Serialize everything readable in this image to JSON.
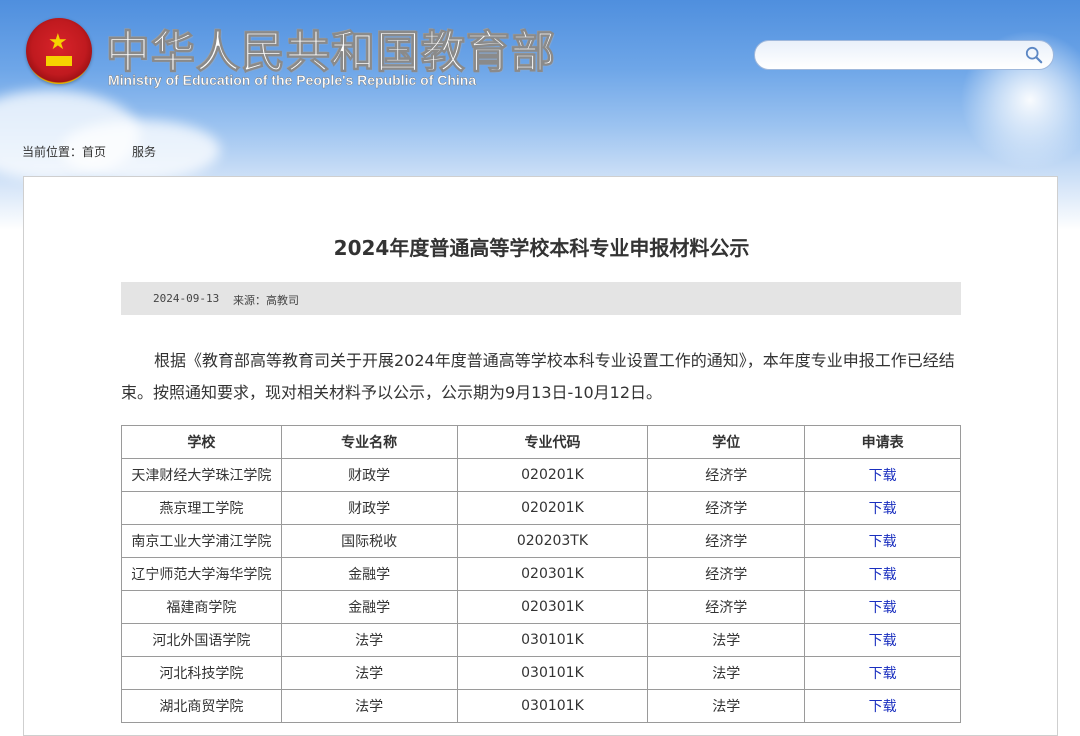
{
  "site": {
    "title": "中华人民共和国教育部",
    "subtitle": "Ministry of Education of the People's Republic of China"
  },
  "search": {
    "value": "",
    "placeholder": ""
  },
  "breadcrumb": {
    "label": "当前位置：",
    "items": [
      "首页",
      "服务"
    ]
  },
  "article": {
    "title": "2024年度普通高等学校本科专业申报材料公示",
    "date": "2024-09-13",
    "source": "来源：高教司",
    "body": "根据《教育部高等教育司关于开展2024年度普通高等学校本科专业设置工作的通知》，本年度专业申报工作已经结束。按照通知要求，现对相关材料予以公示，公示期为9月13日-10月12日。"
  },
  "table": {
    "headers": [
      "学校",
      "专业名称",
      "专业代码",
      "学位",
      "申请表"
    ],
    "rows": [
      [
        "天津财经大学珠江学院",
        "财政学",
        "020201K",
        "经济学",
        "下载"
      ],
      [
        "燕京理工学院",
        "财政学",
        "020201K",
        "经济学",
        "下载"
      ],
      [
        "南京工业大学浦江学院",
        "国际税收",
        "020203TK",
        "经济学",
        "下载"
      ],
      [
        "辽宁师范大学海华学院",
        "金融学",
        "020301K",
        "经济学",
        "下载"
      ],
      [
        "福建商学院",
        "金融学",
        "020301K",
        "经济学",
        "下载"
      ],
      [
        "河北外国语学院",
        "法学",
        "030101K",
        "法学",
        "下载"
      ],
      [
        "河北科技学院",
        "法学",
        "030101K",
        "法学",
        "下载"
      ],
      [
        "湖北商贸学院",
        "法学",
        "030101K",
        "法学",
        "下载"
      ]
    ]
  },
  "colors": {
    "link": "#1a2fbf",
    "header_blue": "#4f8fde",
    "meta_bg": "#e4e4e4"
  }
}
